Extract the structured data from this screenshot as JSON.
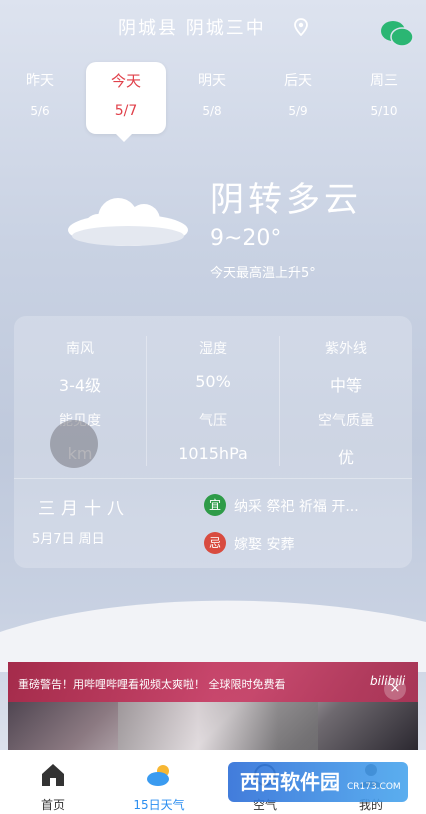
{
  "header": {
    "location": "阴城县 阴城三中",
    "pin_icon": "location-pin-icon",
    "wechat_icon": "wechat-icon"
  },
  "days": [
    {
      "name": "昨天",
      "date": "5/6",
      "active": false
    },
    {
      "name": "今天",
      "date": "5/7",
      "active": true
    },
    {
      "name": "明天",
      "date": "5/8",
      "active": false
    },
    {
      "name": "后天",
      "date": "5/9",
      "active": false
    },
    {
      "name": "周三",
      "date": "5/10",
      "active": false
    }
  ],
  "current": {
    "condition": "阴转多云",
    "temp_range": "9~20°",
    "tip": "今天最高温上升5°",
    "cloud_icon": "cloud-icon"
  },
  "details": {
    "wind_label": "南风",
    "wind_value": "3-4级",
    "humidity_label": "湿度",
    "humidity_value": "50%",
    "uv_label": "紫外线",
    "uv_value": "中等",
    "visibility_label": "能见度",
    "visibility_value": "km",
    "pressure_label": "气压",
    "pressure_value": "1015hPa",
    "aqi_label": "空气质量",
    "aqi_value": "优"
  },
  "almanac": {
    "lunar": "三月十八",
    "date": "5月7日 周日",
    "yi_badge": "宜",
    "yi_text": "纳采 祭祀 祈福 开...",
    "ji_badge": "忌",
    "ji_text": "嫁娶 安葬"
  },
  "ad": {
    "text": "重磅警告！用哔哩哔哩看视频太爽啦！ 全球限时免费看",
    "logo": "bilibili",
    "close": "×"
  },
  "nav": [
    {
      "label": "首页",
      "icon": "home-icon",
      "active": false
    },
    {
      "label": "15日天气",
      "icon": "cloud-sun-icon",
      "active": true
    },
    {
      "label": "空气",
      "icon": "air-icon",
      "active": false
    },
    {
      "label": "我的",
      "icon": "profile-icon",
      "active": false
    }
  ],
  "watermark": {
    "text": "西西软件园",
    "sub": "CR173.COM"
  }
}
